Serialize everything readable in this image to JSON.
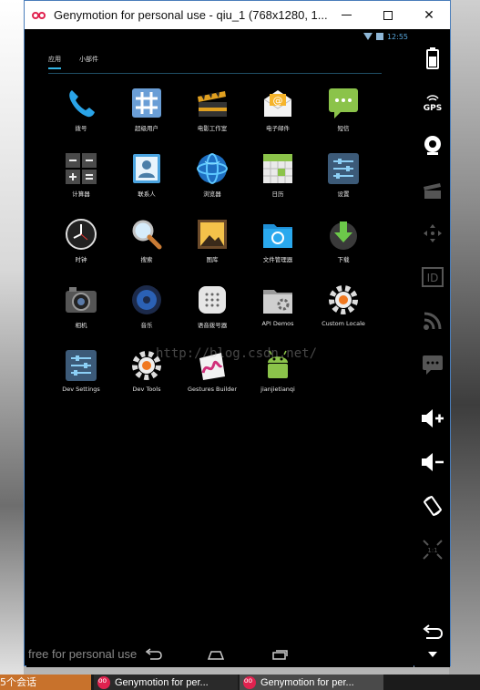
{
  "window": {
    "title": "Genymotion for personal use - qiu_1 (768x1280, 1..."
  },
  "statusbar": {
    "time": "12:55"
  },
  "tabs": [
    {
      "label": "应用",
      "active": true
    },
    {
      "label": "小部件",
      "active": false
    }
  ],
  "apps": [
    {
      "label": "拨号",
      "icon": "phone-icon"
    },
    {
      "label": "超级用户",
      "icon": "superuser-icon"
    },
    {
      "label": "电影工作室",
      "icon": "movie-studio-icon"
    },
    {
      "label": "电子邮件",
      "icon": "email-icon"
    },
    {
      "label": "短信",
      "icon": "messaging-icon"
    },
    {
      "label": "计算器",
      "icon": "calculator-icon"
    },
    {
      "label": "联系人",
      "icon": "contacts-icon"
    },
    {
      "label": "浏览器",
      "icon": "browser-icon"
    },
    {
      "label": "日历",
      "icon": "calendar-icon"
    },
    {
      "label": "设置",
      "icon": "settings-icon"
    },
    {
      "label": "时钟",
      "icon": "clock-icon"
    },
    {
      "label": "搜索",
      "icon": "search-icon"
    },
    {
      "label": "图库",
      "icon": "gallery-icon"
    },
    {
      "label": "文件管理器",
      "icon": "file-manager-icon"
    },
    {
      "label": "下载",
      "icon": "download-icon"
    },
    {
      "label": "相机",
      "icon": "camera-icon"
    },
    {
      "label": "音乐",
      "icon": "music-icon"
    },
    {
      "label": "语音拨号器",
      "icon": "voice-dialer-icon"
    },
    {
      "label": "API Demos",
      "icon": "api-demos-icon"
    },
    {
      "label": "Custom Locale",
      "icon": "custom-locale-icon"
    },
    {
      "label": "Dev Settings",
      "icon": "dev-settings-icon"
    },
    {
      "label": "Dev Tools",
      "icon": "dev-tools-icon"
    },
    {
      "label": "Gestures Builder",
      "icon": "gestures-builder-icon"
    },
    {
      "label": "jianjietianqi",
      "icon": "android-app-icon"
    }
  ],
  "watermark": "http://blog.csdn.net/",
  "navbar": {
    "free_text": "free for personal use"
  },
  "taskbar": {
    "left_text": "5个会话",
    "tasks": [
      {
        "label": "Genymotion for per..."
      },
      {
        "label": "Genymotion for per..."
      }
    ]
  },
  "colors": {
    "accent": "#33b5e5",
    "brand": "#e0224f"
  }
}
